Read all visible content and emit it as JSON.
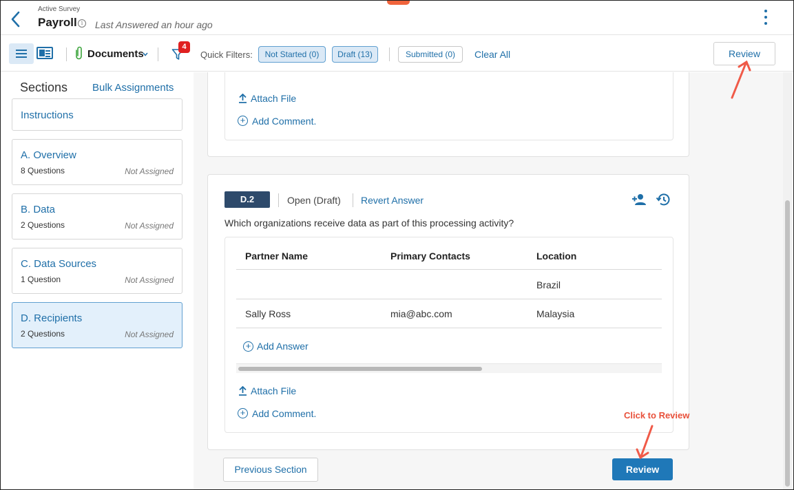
{
  "header": {
    "subtitle": "Active Survey",
    "title": "Payroll",
    "info_glyph": "i",
    "last_answered": "Last Answered an hour ago"
  },
  "toolbar": {
    "documents_label": "Documents",
    "filter_badge": "4",
    "quick_filters_label": "Quick Filters:",
    "chips": [
      {
        "label": "Not Started (0)"
      },
      {
        "label": "Draft (13)"
      },
      {
        "label": "Submitted (0)"
      }
    ],
    "clear_all": "Clear All",
    "review": "Review"
  },
  "sidebar": {
    "title": "Sections",
    "bulk": "Bulk Assignments",
    "items": [
      {
        "name": "Instructions",
        "questions": "",
        "assigned": ""
      },
      {
        "name": "A. Overview",
        "questions": "8 Questions",
        "assigned": "Not Assigned"
      },
      {
        "name": "B. Data",
        "questions": "2 Questions",
        "assigned": "Not Assigned"
      },
      {
        "name": "C. Data Sources",
        "questions": "1 Question",
        "assigned": "Not Assigned"
      },
      {
        "name": "D. Recipients",
        "questions": "2 Questions",
        "assigned": "Not Assigned"
      }
    ]
  },
  "main": {
    "attach_file": "Attach File",
    "add_comment": "Add Comment.",
    "question": {
      "tag": "D.2",
      "status": "Open (Draft)",
      "revert": "Revert Answer",
      "text": "Which organizations receive data as part of this processing activity?",
      "columns": [
        "Partner Name",
        "Primary Contacts",
        "Location"
      ],
      "rows": [
        [
          "",
          "",
          "Brazil"
        ],
        [
          "Sally Ross",
          "mia@abc.com",
          "Malaysia"
        ]
      ],
      "add_answer": "Add Answer"
    },
    "prev_section": "Previous Section",
    "review": "Review"
  },
  "annotation": {
    "text": "Click to Review",
    "color": "#e8503a"
  },
  "colors": {
    "accent": "#1f6fa8",
    "tag_bg": "#2e4a6b",
    "badge": "#e02020",
    "primary_button": "#1f78b8"
  }
}
